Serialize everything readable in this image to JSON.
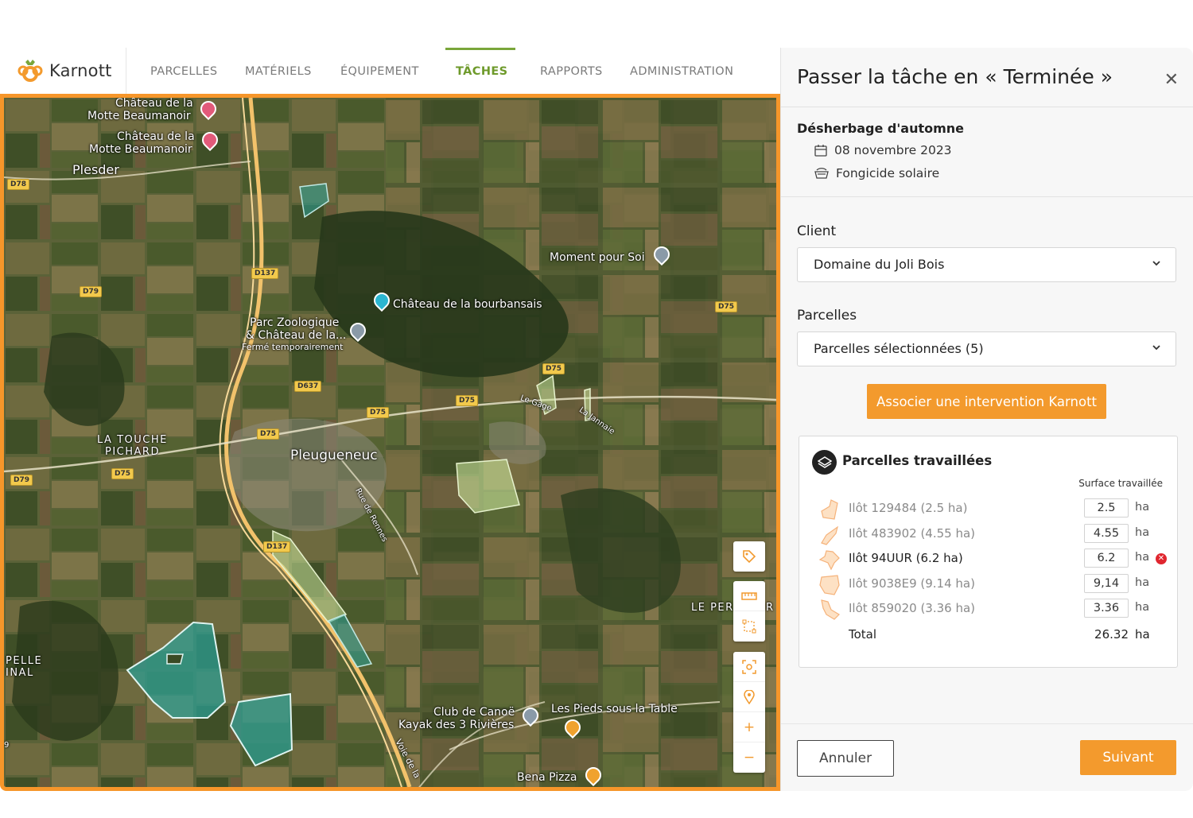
{
  "app": {
    "brand": "Karnott",
    "nav": [
      {
        "label": "PARCELLES",
        "active": false
      },
      {
        "label": "MATÉRIELS",
        "active": false
      },
      {
        "label": "ÉQUIPEMENT",
        "active": false
      },
      {
        "label": "TÂCHES",
        "active": true
      },
      {
        "label": "RAPPORTS",
        "active": false
      },
      {
        "label": "ADMINISTRATION",
        "active": false
      }
    ]
  },
  "map": {
    "places": [
      "Château de la",
      "Motte Beaumanoir",
      "Château de la",
      "Motte Beaumanoir",
      "Plesder",
      "Moment pour Soi",
      "Château de la bourbansais",
      "Parc Zoologique",
      "& Château de la...",
      "Fermé temporairement",
      "LA TOUCHE",
      "PICHARD",
      "Pleugueneuc",
      "Rue de Rennes",
      "Le Gage",
      "La Jannaie",
      "LE PER",
      "R",
      "PELLE",
      "INAL",
      "Club de Canoë",
      "Kayak des 3 Rivières",
      "Les Pieds sous la Table",
      "Bena Pizza",
      "Voie de la",
      "9"
    ],
    "roads": [
      "D78",
      "D137",
      "D79",
      "D75",
      "D75",
      "D637",
      "D75",
      "D75",
      "D75",
      "D79",
      "D75",
      "D137"
    ],
    "colors": {
      "accent": "#f39a2d",
      "field_selected": "#c8e39a",
      "field_done": "#2aa198"
    }
  },
  "panel": {
    "title": "Passer la tâche en « Terminée »",
    "close_icon": "close-icon",
    "task_name": "Désherbage d'automne",
    "date": "08 novembre 2023",
    "product": "Fongicide solaire",
    "client_label": "Client",
    "client_value": "Domaine du Joli Bois",
    "parcels_label": "Parcelles",
    "parcels_value": "Parcelles sélectionnées (5)",
    "associate_button": "Associer une intervention Karnott",
    "worked": {
      "title": "Parcelles travaillées",
      "surface_header": "Surface travaillée",
      "rows": [
        {
          "name": "Ilôt 129484 (2.5 ha)",
          "value": "2.5",
          "unit": "ha",
          "selected": false,
          "error": false
        },
        {
          "name": "Ilôt 483902 (4.55 ha)",
          "value": "4.55",
          "unit": "ha",
          "selected": false,
          "error": false
        },
        {
          "name": "Ilôt 94UUR (6.2 ha)",
          "value": "6.2",
          "unit": "ha",
          "selected": true,
          "error": true
        },
        {
          "name": "Ilôt 9038E9 (9.14 ha)",
          "value": "9,14",
          "unit": "ha",
          "selected": false,
          "error": false
        },
        {
          "name": "Ilôt 859020 (3.36 ha)",
          "value": "3.36",
          "unit": "ha",
          "selected": false,
          "error": false
        }
      ],
      "total_label": "Total",
      "total_value": "26.32",
      "total_unit": "ha"
    },
    "cancel_button": "Annuler",
    "next_button": "Suivant"
  }
}
